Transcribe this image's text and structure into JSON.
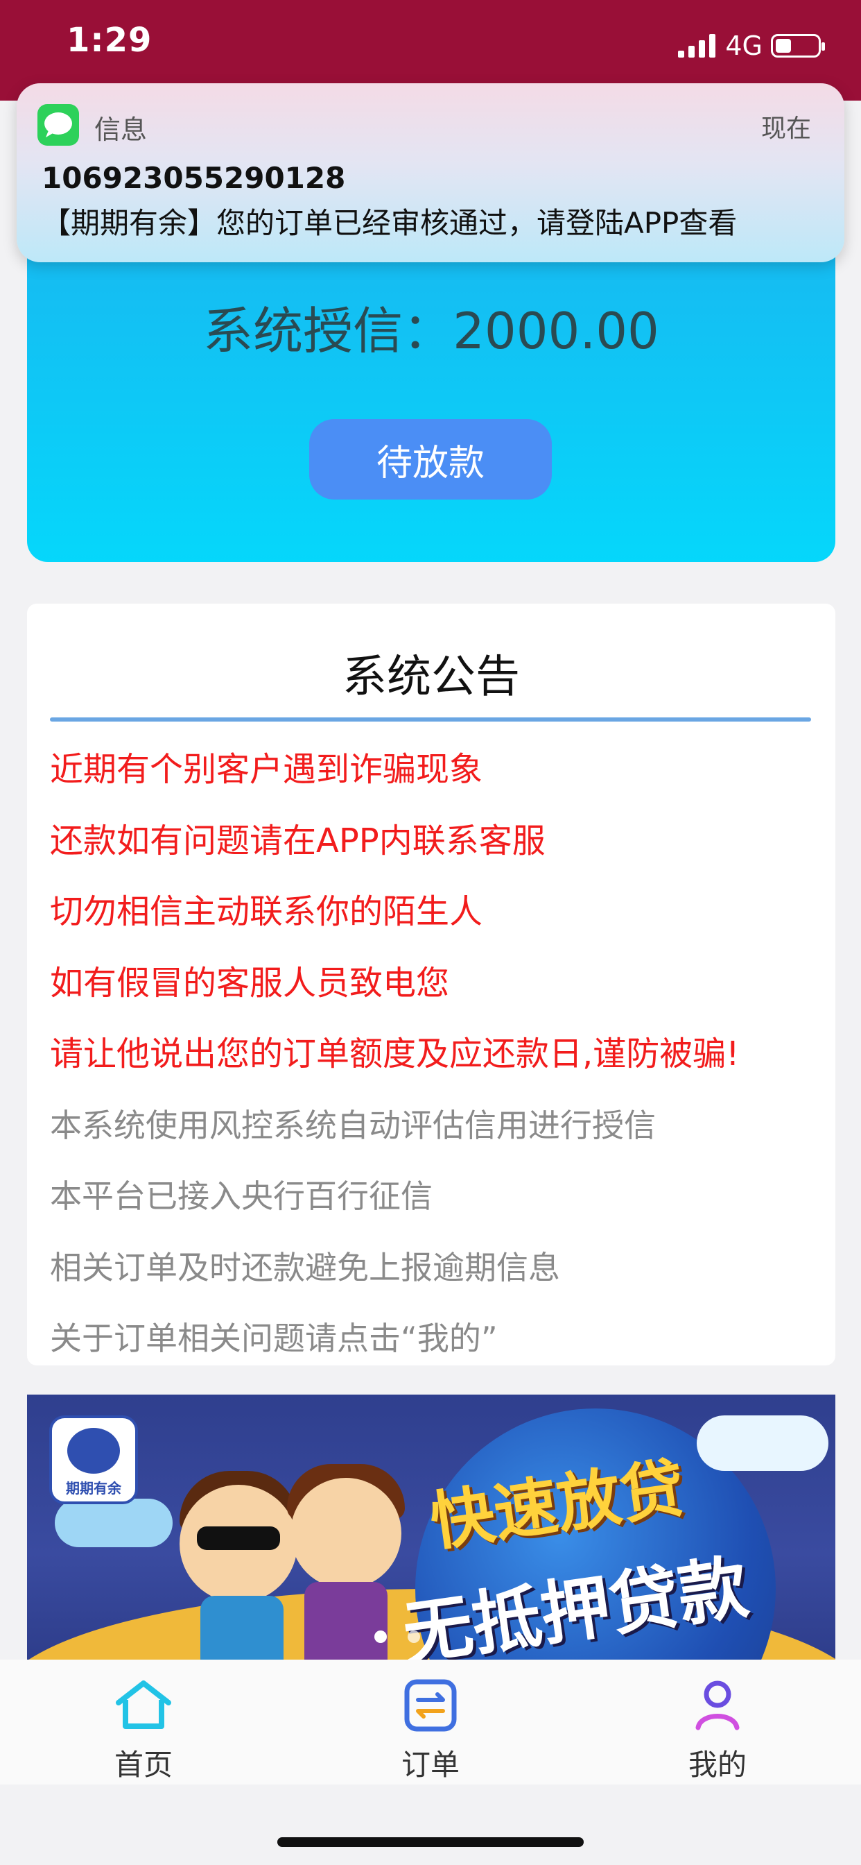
{
  "status_bar": {
    "time": "1:29",
    "network": "4G",
    "battery_level": 0.25
  },
  "notification": {
    "app_name": "信息",
    "time": "现在",
    "sender": "106923055290128",
    "body": "【期期有余】您的订单已经审核通过，请登陆APP查看"
  },
  "credit": {
    "label": "系统授信：2000.00",
    "status_button": "待放款"
  },
  "announcement": {
    "title": "系统公告",
    "red_items": [
      "近期有个别客户遇到诈骗现象",
      "还款如有问题请在APP内联系客服",
      "切勿相信主动联系你的陌生人",
      "如有假冒的客服人员致电您",
      "请让他说出您的订单额度及应还款日,谨防被骗!"
    ],
    "gray_items": [
      "本系统使用风控系统自动评估信用进行授信",
      "本平台已接入央行百行征信",
      "相关订单及时还款避免上报逾期信息",
      "关于订单相关问题请点击“我的”"
    ]
  },
  "banner": {
    "logo_text": "期期有余",
    "headline": "快速放贷",
    "subline": "无抵押贷款"
  },
  "tabs": [
    {
      "label": "首页",
      "icon": "home-icon",
      "color": "#22c3e6"
    },
    {
      "label": "订单",
      "icon": "order-icon",
      "color": "#3f6fe0"
    },
    {
      "label": "我的",
      "icon": "user-icon",
      "color": "#6a4de0"
    }
  ]
}
